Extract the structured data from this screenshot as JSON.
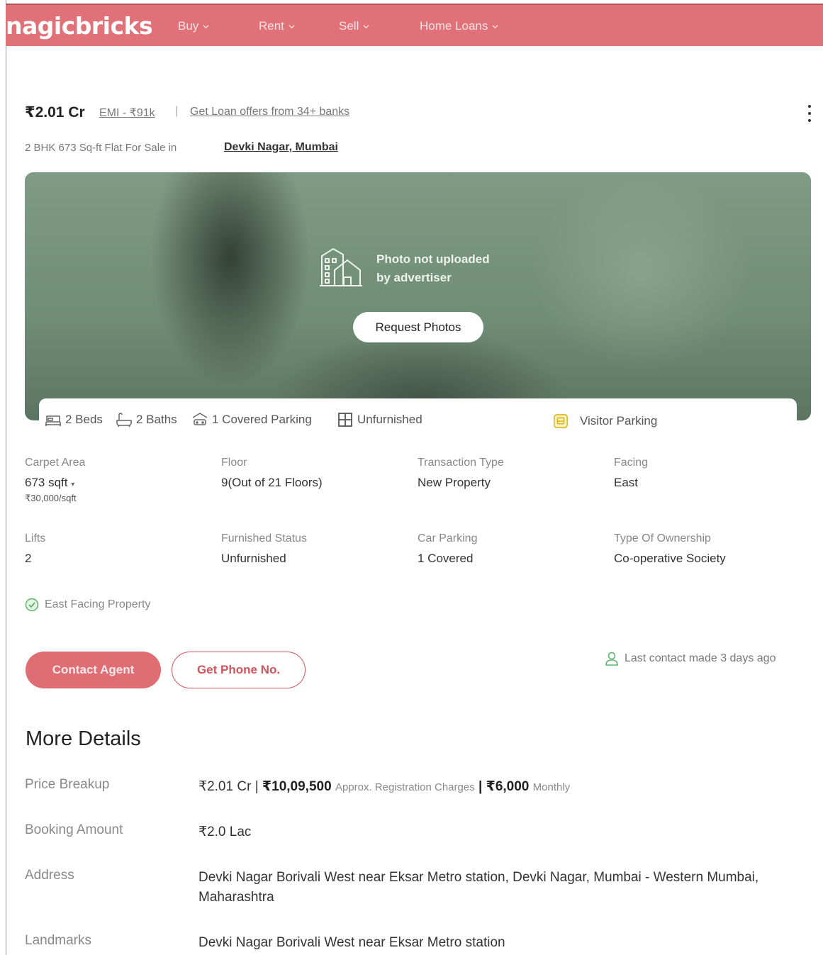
{
  "nav": {
    "brand": "nagicbricks",
    "items": [
      "Buy",
      "Rent",
      "Sell",
      "Home Loans"
    ]
  },
  "listing": {
    "price": "₹2.01 Cr",
    "emi": "EMI - ₹91k",
    "separator": "|",
    "loan_offers": "Get Loan offers from 34+ banks",
    "subtitle": "2 BHK 673 Sq-ft Flat For Sale in",
    "locality": "Devki Nagar, Mumbai"
  },
  "hero": {
    "message_line1": "Photo not uploaded",
    "message_line2": "by advertiser",
    "request_button": "Request Photos",
    "icon": "building-icon"
  },
  "amenities": [
    {
      "label": "2 Beds",
      "icon": "bed-icon"
    },
    {
      "label": "2 Baths",
      "icon": "bath-icon"
    },
    {
      "label": "1 Covered Parking",
      "icon": "car-icon"
    },
    {
      "label": "Unfurnished",
      "icon": "window-icon"
    },
    {
      "label": "Visitor Parking",
      "icon": "parking-icon"
    }
  ],
  "specs": {
    "carpet_area": {
      "label": "Carpet Area",
      "value": "673 sqft",
      "sub": "₹30,000/sqft"
    },
    "floor": {
      "label": "Floor",
      "value": "9(Out of 21 Floors)"
    },
    "transaction": {
      "label": "Transaction Type",
      "value": "New Property"
    },
    "facing": {
      "label": "Facing",
      "value": "East"
    },
    "lifts": {
      "label": "Lifts",
      "value": "2"
    },
    "furnished": {
      "label": "Furnished Status",
      "value": "Unfurnished"
    },
    "car_parking": {
      "label": "Car Parking",
      "value": "1 Covered"
    },
    "ownership": {
      "label": "Type Of Ownership",
      "value": "Co-operative Society"
    }
  },
  "highlight": "East Facing Property",
  "actions": {
    "contact": "Contact Agent",
    "phone": "Get Phone No.",
    "last_contact": "Last contact made 3 days ago"
  },
  "more_details": {
    "title": "More Details",
    "price_breakup": {
      "label": "Price Breakup",
      "price": "₹2.01 Cr",
      "sep1": "|",
      "registration": "₹10,09,500",
      "registration_note": "Approx. Registration Charges",
      "sep2": "|",
      "monthly": "₹6,000",
      "monthly_note": "Monthly"
    },
    "booking": {
      "label": "Booking Amount",
      "value": "₹2.0 Lac"
    },
    "address": {
      "label": "Address",
      "value": "Devki Nagar Borivali West near Eksar Metro station, Devki Nagar, Mumbai - Western Mumbai, Maharashtra"
    },
    "landmarks": {
      "label": "Landmarks",
      "value": "Devki Nagar Borivali West near Eksar Metro station"
    }
  },
  "colors": {
    "brand": "#e07178",
    "accent": "#d0545c",
    "success": "#5fb36b"
  }
}
